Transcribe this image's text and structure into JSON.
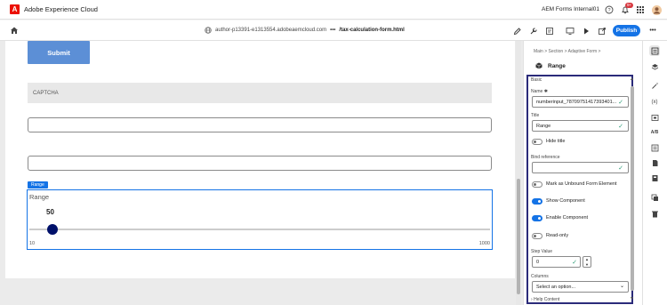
{
  "app": {
    "title": "Adobe Experience Cloud",
    "logo": "A",
    "org": "AEM Forms Internal01",
    "notification_count": "9+"
  },
  "toolbar": {
    "host": "author-p13391-e1313554.adobeaemcloud.com",
    "more": "•••",
    "path": "/tax-calculation-form.html",
    "publish_label": "Publish",
    "menu": "•••"
  },
  "canvas": {
    "submit_label": "Submit",
    "captcha_label": "CAPTCHA",
    "range": {
      "tag": "Range",
      "title": "Range",
      "value": "50",
      "min": "10",
      "max": "1000",
      "knob_fraction": 0.04
    }
  },
  "panel": {
    "breadcrumb": "Main  >  Section  >  Adaptive Form  >",
    "heading": "Range",
    "section": "Basic",
    "name_label": "Name ✱",
    "name_value": "numberinput_78709751417393401...",
    "title_label": "Title",
    "title_value": "Range",
    "hide_title": "Hide title",
    "bind_label": "Bind reference",
    "unbound": "Mark as Unbound Form Element",
    "show_component": "Show Component",
    "enable_component": "Enable Component",
    "read_only": "Read-only",
    "step_label": "Step Value",
    "step_value": "0",
    "columns_label": "Columns",
    "columns_placeholder": "Select an option...",
    "help_content": "Help Content"
  },
  "rail": {
    "ab_label": "A/B",
    "x_label": "(x)"
  },
  "colors": {
    "accent": "#1473e6",
    "submit": "#5c8fd6",
    "knob": "#00106a",
    "highlight_border": "#2b2b7a",
    "check": "#2d9d78"
  }
}
